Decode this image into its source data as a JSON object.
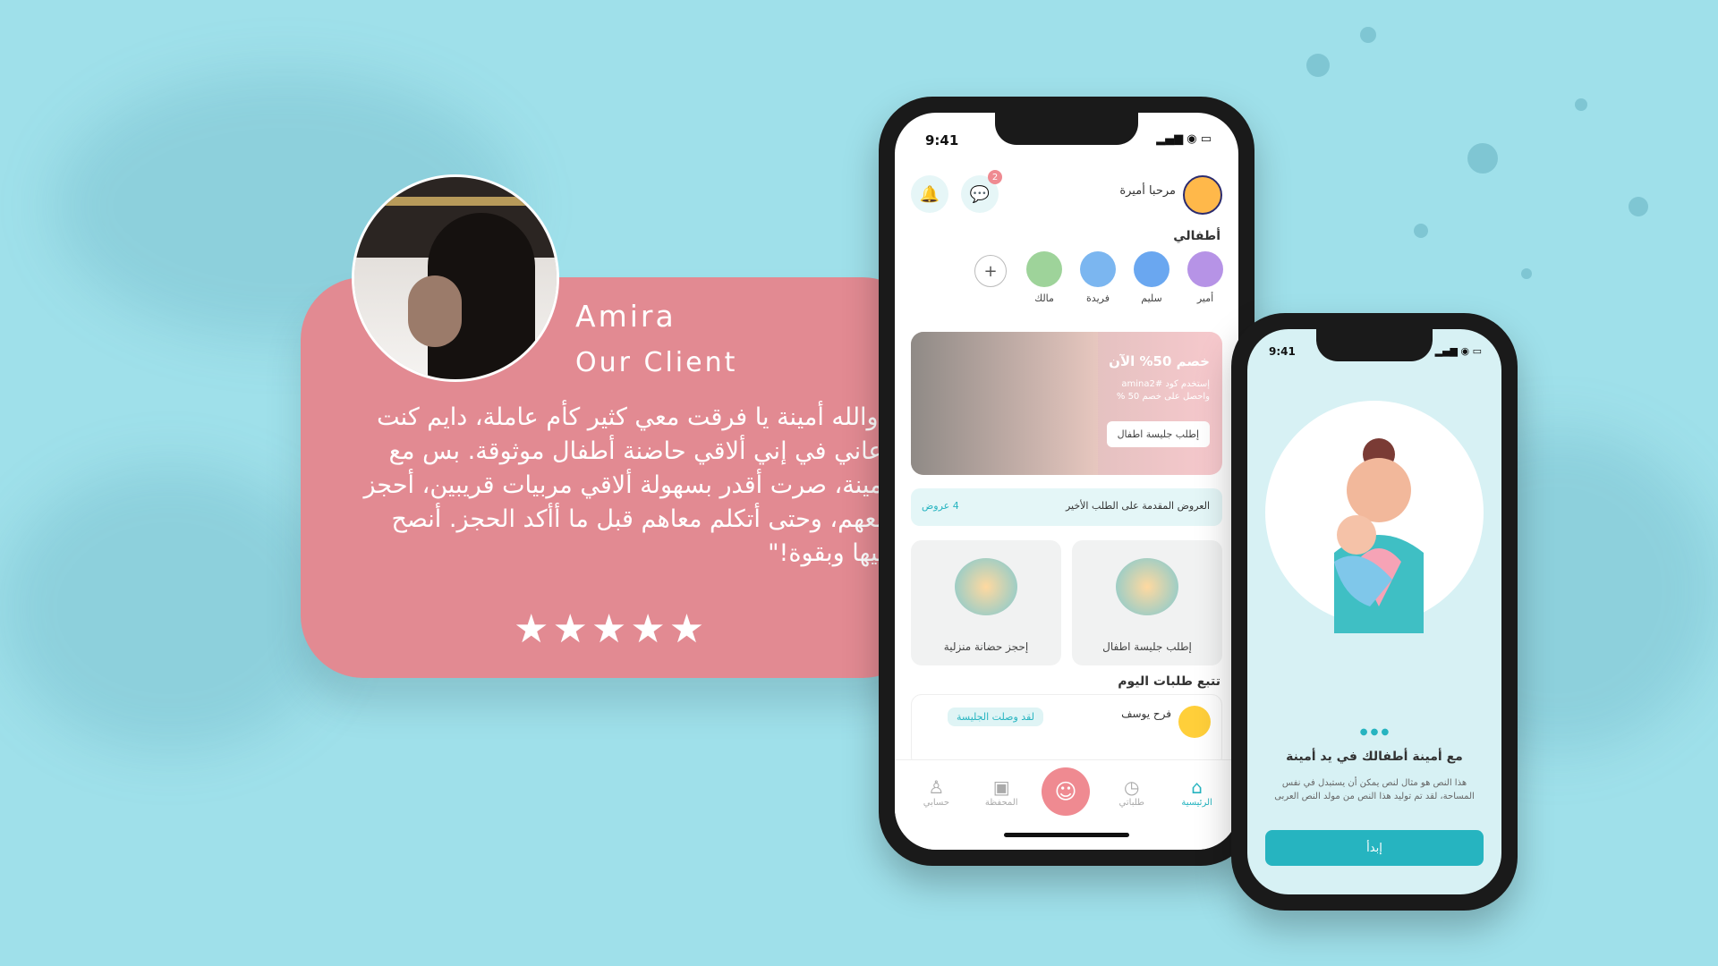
{
  "testimonial": {
    "name": "Amira",
    "role": "Our Client",
    "quote": "\"والله  أمينة يا فرقت معي كثير كأم عاملة، دايم كنت أعاني في إني ألاقي حاضنة أطفال موثوقة. بس مع أمينة، صرت أقدر بسهولة ألاقي مربيات قريبين، أحجز معهم، وحتى أتكلم معاهم قبل ما أأكد الحجز. أنصح فيها وبقوة!\"",
    "stars": "★★★★★",
    "rating": 5
  },
  "phone1": {
    "time": "9:41",
    "greeting": "مرحبا أميرة",
    "message_badge": "2",
    "kids_title": "أطفالي",
    "kids": [
      {
        "name": "أمير",
        "color": "#b693e6"
      },
      {
        "name": "سليم",
        "color": "#6aa7f0"
      },
      {
        "name": "فريدة",
        "color": "#7bb6f0"
      },
      {
        "name": "مالك",
        "color": "#9ed39a"
      }
    ],
    "add_kid": "+",
    "banner": {
      "title": "خصم 50% الآن",
      "subtitle": "إستخدم كود #amina2 واحصل على خصم 50 %",
      "button": "إطلب جليسة اطفال"
    },
    "offers": {
      "title": "العروض المقدمة على الطلب الأخير",
      "count": "4 عروض"
    },
    "tiles": [
      {
        "label": "إطلب جليسة اطفال"
      },
      {
        "label": "إحجز حضانة منزلية"
      }
    ],
    "track_title": "تتبع طلبات اليوم",
    "track_item": {
      "name": "فرح يوسف",
      "status": "لقد وصلت الجليسة"
    },
    "nav": [
      {
        "label": "الرئيسية",
        "icon": "home-icon",
        "active": true
      },
      {
        "label": "طلباتي",
        "icon": "clock-icon"
      },
      {
        "label": "",
        "icon": "baby-icon"
      },
      {
        "label": "المحفظة",
        "icon": "wallet-icon"
      },
      {
        "label": "حسابي",
        "icon": "user-icon"
      }
    ]
  },
  "phone2": {
    "time": "9:41",
    "title": "مع أمينة أطفالك في يد أمينة",
    "body": "هذا النص هو مثال لنص يمكن أن يستبدل في نفس المساحة، لقد تم توليد هذا النص من مولد النص العربى",
    "button": "إبدأ"
  }
}
